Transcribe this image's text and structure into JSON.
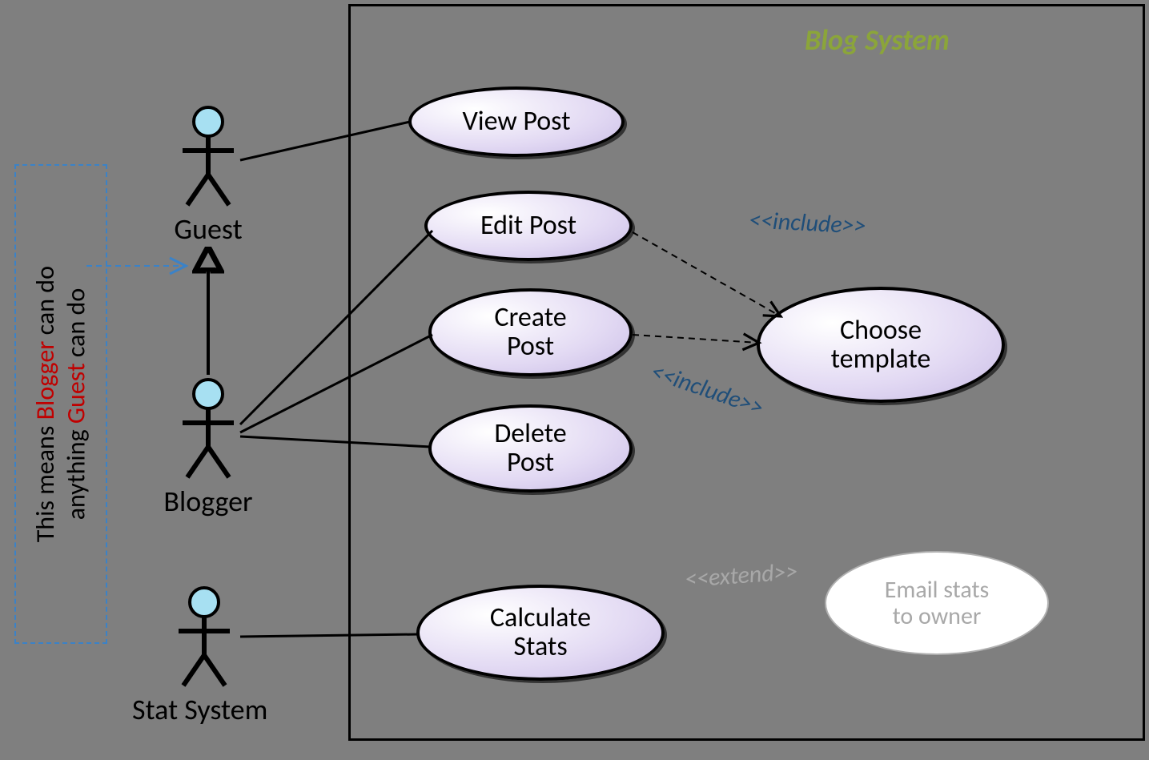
{
  "system": {
    "title": "Blog System"
  },
  "actors": {
    "guest": "Guest",
    "blogger": "Blogger",
    "statsystem": "Stat System"
  },
  "usecases": {
    "view_post": "View Post",
    "edit_post": "Edit Post",
    "create_post": "Create\nPost",
    "delete_post": "Delete\nPost",
    "calculate_stats": "Calculate\nStats",
    "choose_template": "Choose\ntemplate",
    "email_stats": "Email stats\nto owner"
  },
  "stereotypes": {
    "include1": "<<include>>",
    "include2": "<<include>>",
    "extend_ghost": "<<extend>>"
  },
  "note": {
    "prefix": "This means ",
    "word1": "Blogger",
    "mid": " can do\nanything ",
    "word2": "Guest",
    "suffix": " can do"
  }
}
